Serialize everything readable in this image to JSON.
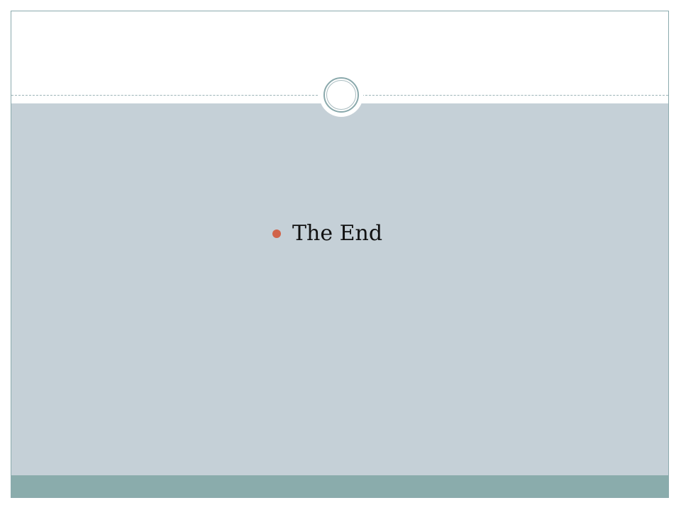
{
  "slide": {
    "bullets": [
      {
        "text": "The End"
      }
    ]
  },
  "colors": {
    "content_background": "#c5d0d7",
    "footer_band": "#8aacac",
    "bullet": "#d16349",
    "border": "#8aaaad"
  }
}
